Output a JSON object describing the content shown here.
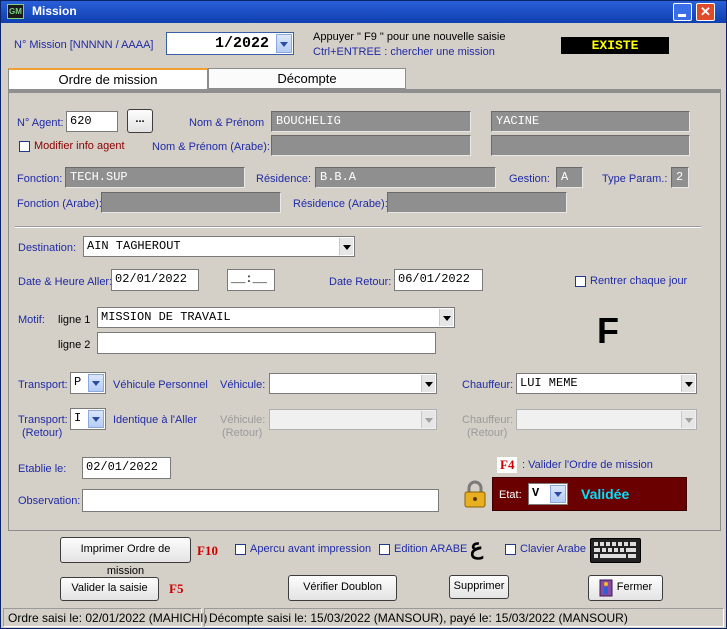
{
  "window": {
    "title": "Mission",
    "app_icon": "GM"
  },
  "header": {
    "mission_label": "N° Mission  [NNNNN / AAAA]",
    "mission_value": "1/2022",
    "hint_line1": "Appuyer \" F9 \" pour une nouvelle saisie",
    "hint_line2": "Ctrl+ENTREE : chercher une mission",
    "status": "EXISTE"
  },
  "tabs": [
    {
      "label": "Ordre de mission"
    },
    {
      "label": "Décompte"
    }
  ],
  "agent": {
    "num_label": "N° Agent:",
    "num_value": "620",
    "lookup_label": "...",
    "modify_label": "Modifier info agent",
    "name_label": "Nom & Prénom",
    "nom": "BOUCHELIG",
    "prenom": "YACINE",
    "name_ar_label": "Nom & Prénom (Arabe):",
    "fonction_label": "Fonction:",
    "fonction": "TECH.SUP",
    "residence_label": "Résidence:",
    "residence": "B.B.A",
    "gestion_label": "Gestion:",
    "gestion": "A",
    "type_param_label": "Type Param.:",
    "type_param": "2",
    "fonction_ar_label": "Fonction (Arabe):",
    "residence_ar_label": "Résidence (Arabe):"
  },
  "mission": {
    "destination_label": "Destination:",
    "destination": "AIN TAGHEROUT",
    "date_aller_label": "Date & Heure Aller:",
    "date_aller": "02/01/2022",
    "heure_aller": "__:__",
    "date_retour_label": "Date Retour:",
    "date_retour": "06/01/2022",
    "rentrer_label": "Rentrer chaque jour",
    "motif_label": "Motif:",
    "ligne1_label": "ligne 1",
    "ligne1": "MISSION DE TRAVAIL",
    "ligne2_label": "ligne 2",
    "big_letter": "F",
    "transport_label": "Transport:",
    "transport": "P",
    "transport_desc": "Véhicule Personnel",
    "vehicule_label": "Véhicule:",
    "chauffeur_label": "Chauffeur:",
    "chauffeur": "LUI MEME",
    "transport_ret_label1": "Transport:",
    "transport_ret_label2": "(Retour)",
    "transport_ret": "I",
    "transport_ret_desc": "Identique à l'Aller",
    "vehicule_ret_label1": "Véhicule:",
    "vehicule_ret_label2": "(Retour)",
    "chauffeur_ret_label1": "Chauffeur:",
    "chauffeur_ret_label2": "(Retour)",
    "etablie_label": "Etablie le:",
    "etablie": "02/01/2022",
    "observation_label": "Observation:",
    "f4_key": "F4",
    "f4_label": ": Valider l'Ordre de mission",
    "etat_label": "Etat:",
    "etat": "V",
    "etat_text": "Validée"
  },
  "print_bar": {
    "print_button": "Imprimer Ordre de mission",
    "f10": "F10",
    "apercu_label": "Apercu avant impression",
    "edition_arabe_label": "Edition ARABE",
    "arabic_glyph": "ع",
    "clavier_label": "Clavier Arabe"
  },
  "footer": {
    "valider_button": "Valider la saisie",
    "f5": "F5",
    "verifier_button": "Vérifier Doublon",
    "supprimer_button": "Supprimer",
    "fermer_button": "Fermer"
  },
  "status_bar": {
    "left": "Ordre saisi le: 02/01/2022 (MAHICHI)",
    "right": "Décompte saisi le: 15/03/2022 (MANSOUR), payé le: 15/03/2022 (MANSOUR)"
  },
  "colors": {
    "status_bg": "#000000",
    "status_fg": "#ffff00",
    "etat_bg": "#6b0000",
    "etat_fg": "#00e0ff"
  }
}
